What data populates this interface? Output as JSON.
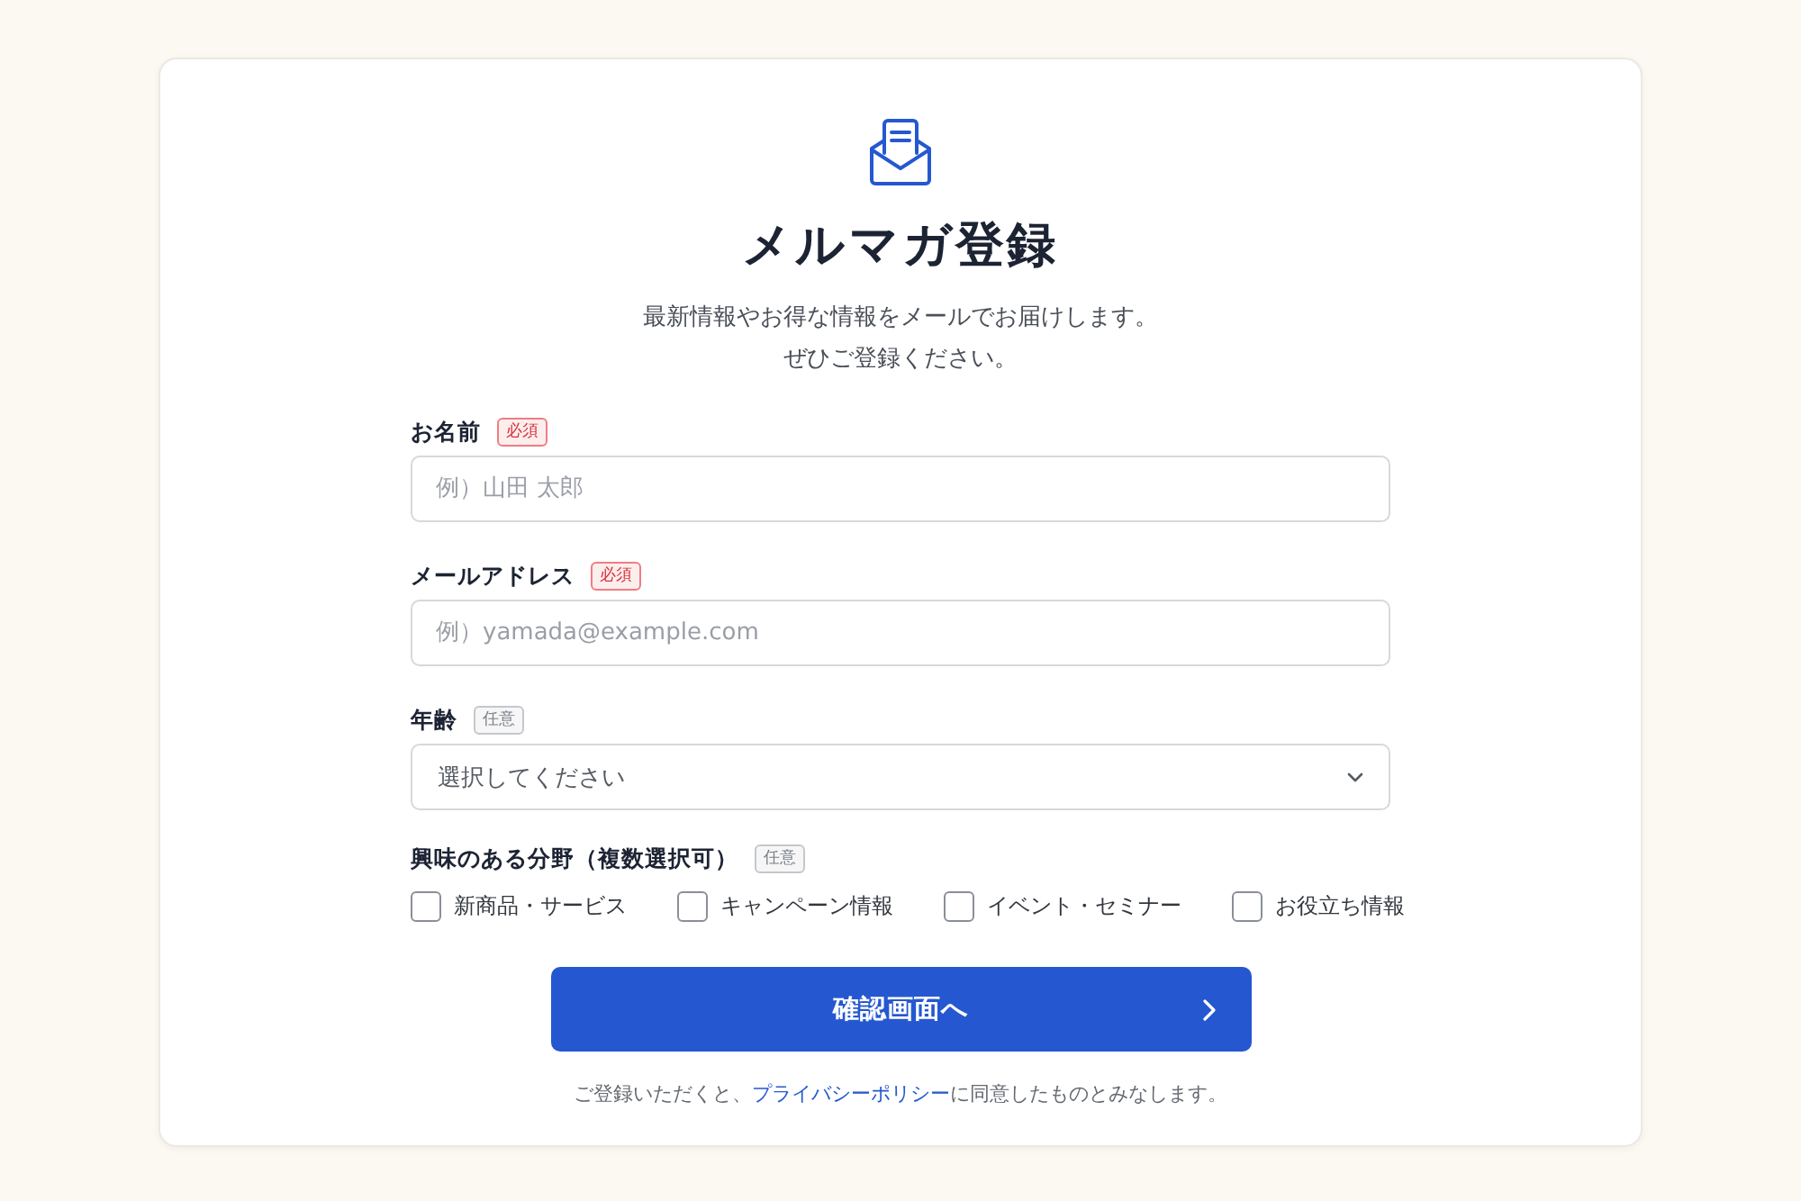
{
  "header": {
    "title": "メルマガ登録",
    "description": [
      "最新情報やお得な情報をメールでお届けします。",
      "ぜひご登録ください。"
    ]
  },
  "fields": [
    {
      "kind": "text",
      "label": "お名前",
      "badge": {
        "kind": "required",
        "text": "必須"
      },
      "placeholder": "例）山田 太郎"
    },
    {
      "kind": "text",
      "label": "メールアドレス",
      "badge": {
        "kind": "required",
        "text": "必須"
      },
      "placeholder": "例）yamada@example.com"
    },
    {
      "kind": "select",
      "label": "年齢",
      "badge": {
        "kind": "optional",
        "text": "任意"
      },
      "placeholder": "選択してください"
    },
    {
      "kind": "checkboxes",
      "label": "興味のある分野（複数選択可）",
      "badge": {
        "kind": "optional",
        "text": "任意"
      },
      "options": [
        {
          "label": "新商品・サービス",
          "checked": false
        },
        {
          "label": "キャンペーン情報",
          "checked": false
        },
        {
          "label": "イベント・セミナー",
          "checked": false
        },
        {
          "label": "お役立ち情報",
          "checked": false
        }
      ]
    }
  ],
  "submit_button": {
    "label": "確認画面へ"
  },
  "footer": {
    "text_before": "ご登録いただくと、",
    "link": "プライバシーポリシー",
    "text_after": "に同意したものとみなします。"
  }
}
